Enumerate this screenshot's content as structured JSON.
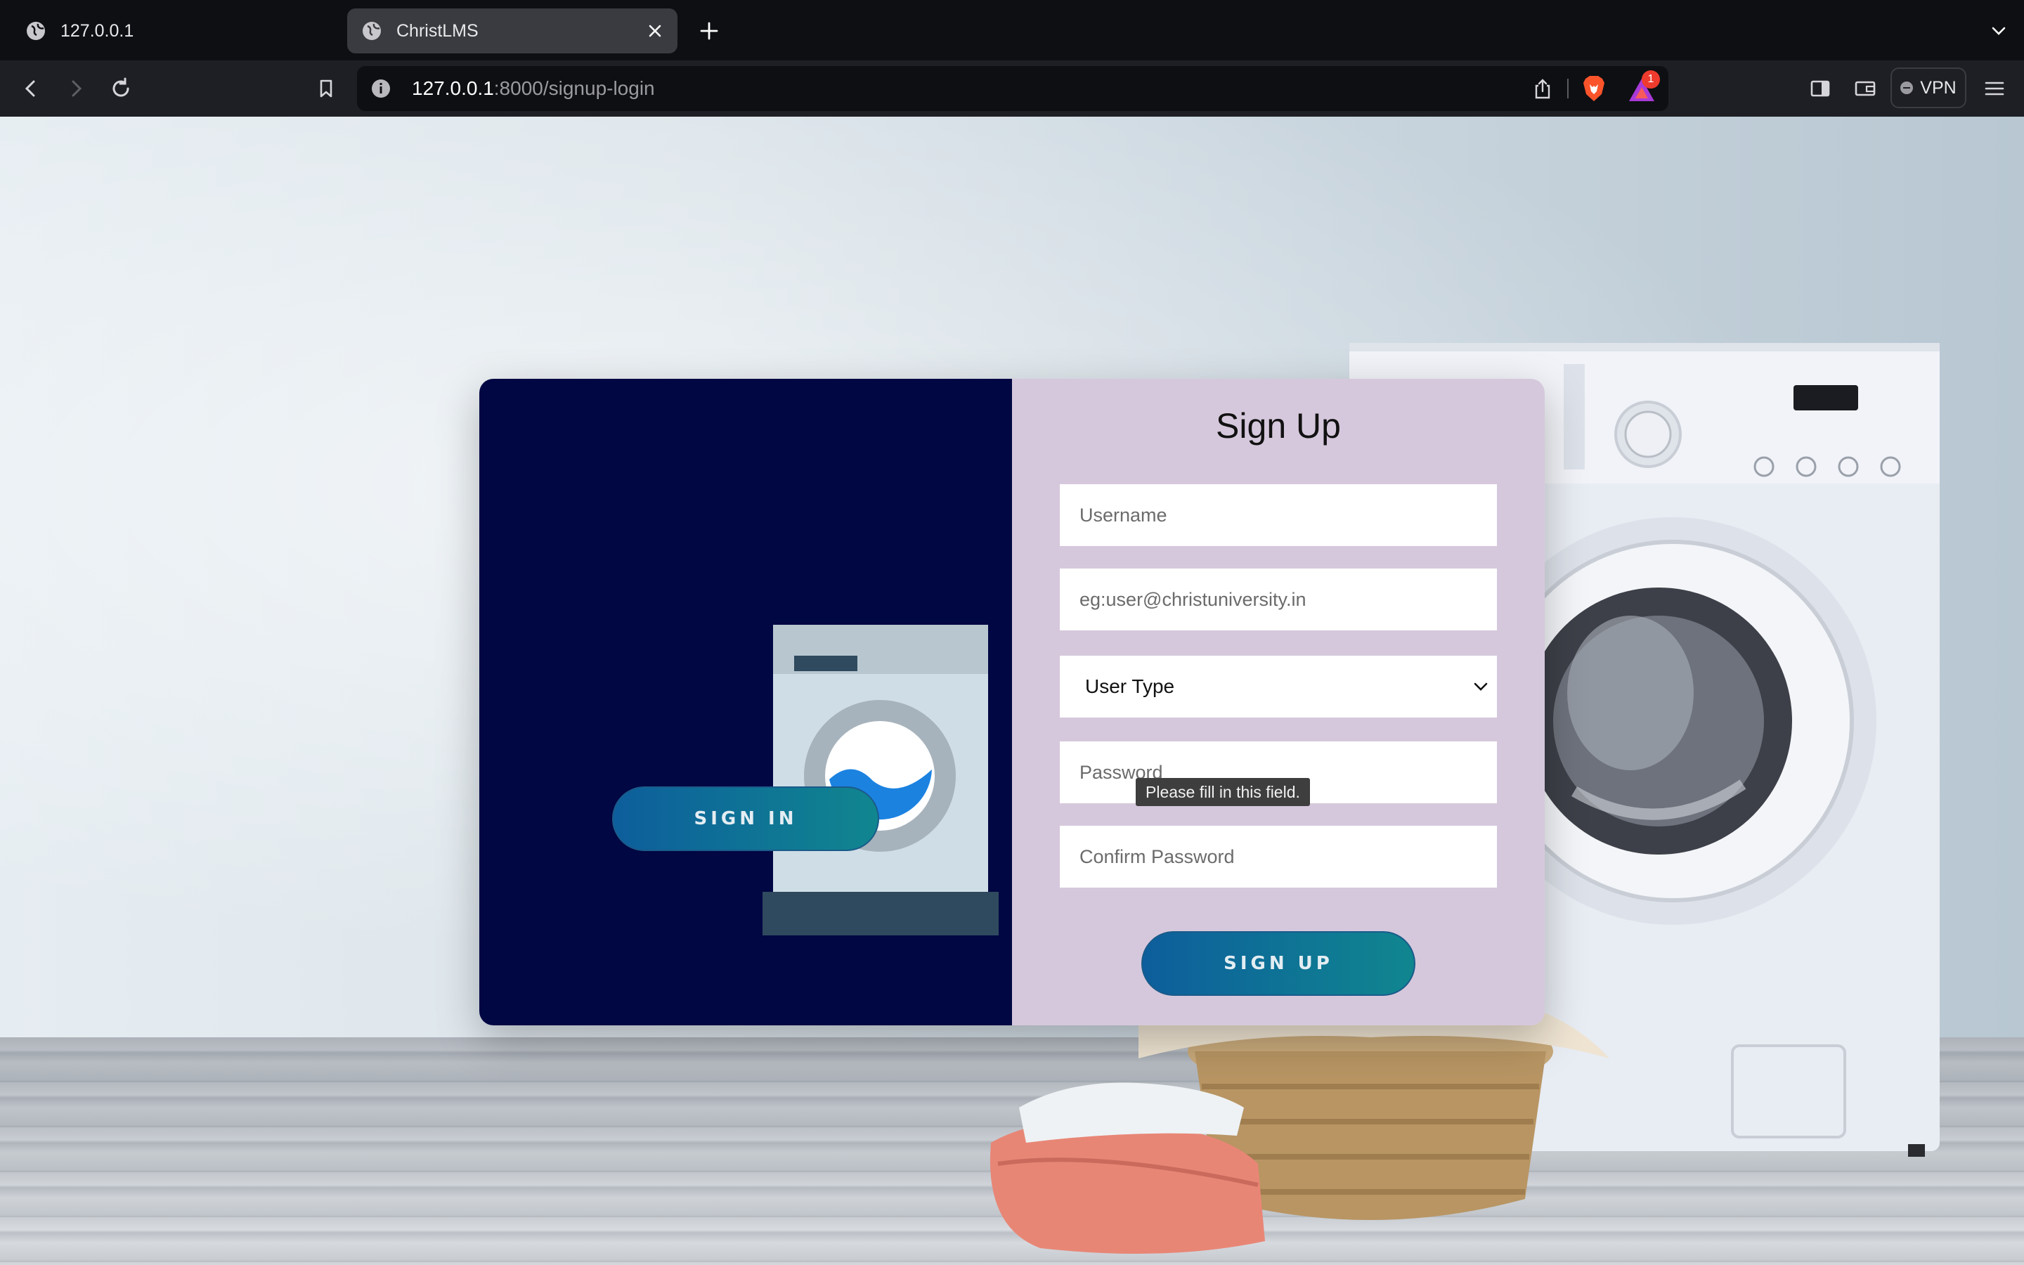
{
  "browser": {
    "tabs": [
      {
        "title": "127.0.0.1",
        "active": false
      },
      {
        "title": "ChristLMS",
        "active": true
      }
    ],
    "url": {
      "host": "127.0.0.1",
      "rest": ":8000/signup-login"
    },
    "rewards_badge": "1",
    "vpn_label": "VPN"
  },
  "page": {
    "signin_label": "SIGN IN",
    "signup_title": "Sign Up",
    "fields": {
      "username_placeholder": "Username",
      "email_placeholder": "eg:user@christuniversity.in",
      "user_type_selected": "User Type",
      "password_placeholder": "Password",
      "confirm_placeholder": "Confirm Password"
    },
    "validation_tooltip": "Please fill in this field.",
    "signup_label": "SIGN UP"
  },
  "colors": {
    "left_panel": "#010743",
    "right_panel": "#d6c8dc",
    "button_gradient_start": "#0d5e9c",
    "button_gradient_end": "#10868f"
  }
}
